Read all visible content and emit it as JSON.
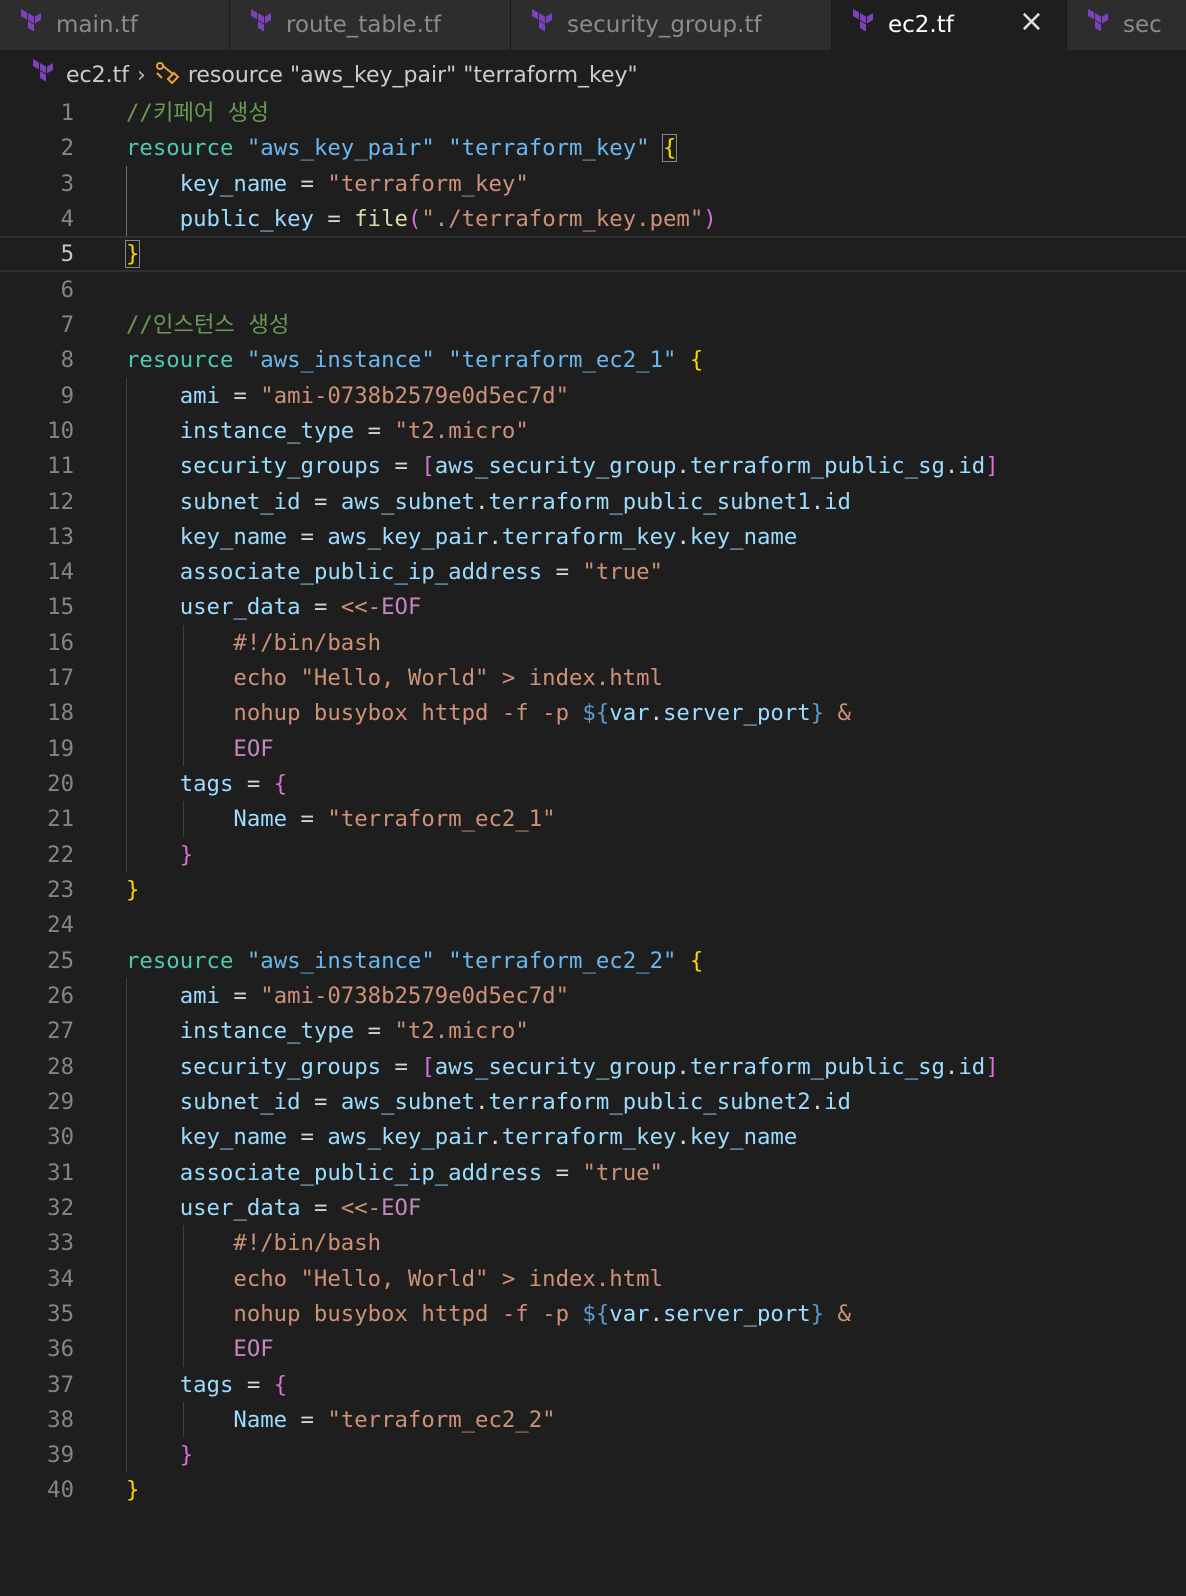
{
  "tabs": [
    {
      "label": "main.tf",
      "icon": "terraform-icon",
      "active": false
    },
    {
      "label": "route_table.tf",
      "icon": "terraform-icon",
      "active": false
    },
    {
      "label": "security_group.tf",
      "icon": "terraform-icon",
      "active": false
    },
    {
      "label": "ec2.tf",
      "icon": "terraform-icon",
      "active": true
    },
    {
      "label": "sec",
      "icon": "terraform-icon",
      "active": false
    }
  ],
  "breadcrumb": {
    "file": "ec2.tf",
    "symbol": "resource \"aws_key_pair\" \"terraform_key\""
  },
  "editor": {
    "current_line": 5,
    "lines": [
      [
        [
          "com",
          "//키페어 생성"
        ]
      ],
      [
        [
          "kw",
          "resource"
        ],
        [
          "p",
          " "
        ],
        [
          "lbl",
          "\"aws_key_pair\""
        ],
        [
          "p",
          " "
        ],
        [
          "lbl",
          "\"terraform_key\""
        ],
        [
          "p",
          " "
        ],
        [
          "b1bm",
          "{"
        ]
      ],
      [
        [
          "p",
          "    "
        ],
        [
          "var",
          "key_name"
        ],
        [
          "p",
          " = "
        ],
        [
          "str",
          "\"terraform_key\""
        ]
      ],
      [
        [
          "p",
          "    "
        ],
        [
          "var",
          "public_key"
        ],
        [
          "p",
          " = "
        ],
        [
          "fn",
          "file"
        ],
        [
          "b2",
          "("
        ],
        [
          "str",
          "\"./terraform_key.pem\""
        ],
        [
          "b2",
          ")"
        ]
      ],
      [
        [
          "b1bm",
          "}"
        ]
      ],
      [],
      [
        [
          "com",
          "//인스턴스 생성"
        ]
      ],
      [
        [
          "kw",
          "resource"
        ],
        [
          "p",
          " "
        ],
        [
          "lbl",
          "\"aws_instance\""
        ],
        [
          "p",
          " "
        ],
        [
          "lbl",
          "\"terraform_ec2_1\""
        ],
        [
          "p",
          " "
        ],
        [
          "b1",
          "{"
        ]
      ],
      [
        [
          "p",
          "    "
        ],
        [
          "var",
          "ami"
        ],
        [
          "p",
          " = "
        ],
        [
          "str",
          "\"ami-0738b2579e0d5ec7d\""
        ]
      ],
      [
        [
          "p",
          "    "
        ],
        [
          "var",
          "instance_type"
        ],
        [
          "p",
          " = "
        ],
        [
          "str",
          "\"t2.micro\""
        ]
      ],
      [
        [
          "p",
          "    "
        ],
        [
          "var",
          "security_groups"
        ],
        [
          "p",
          " = "
        ],
        [
          "b2",
          "["
        ],
        [
          "var",
          "aws_security_group"
        ],
        [
          "p",
          "."
        ],
        [
          "var",
          "terraform_public_sg"
        ],
        [
          "p",
          "."
        ],
        [
          "var",
          "id"
        ],
        [
          "b2",
          "]"
        ]
      ],
      [
        [
          "p",
          "    "
        ],
        [
          "var",
          "subnet_id"
        ],
        [
          "p",
          " = "
        ],
        [
          "var",
          "aws_subnet"
        ],
        [
          "p",
          "."
        ],
        [
          "var",
          "terraform_public_subnet1"
        ],
        [
          "p",
          "."
        ],
        [
          "var",
          "id"
        ]
      ],
      [
        [
          "p",
          "    "
        ],
        [
          "var",
          "key_name"
        ],
        [
          "p",
          " = "
        ],
        [
          "var",
          "aws_key_pair"
        ],
        [
          "p",
          "."
        ],
        [
          "var",
          "terraform_key"
        ],
        [
          "p",
          "."
        ],
        [
          "var",
          "key_name"
        ]
      ],
      [
        [
          "p",
          "    "
        ],
        [
          "var",
          "associate_public_ip_address"
        ],
        [
          "p",
          " = "
        ],
        [
          "str",
          "\"true\""
        ]
      ],
      [
        [
          "p",
          "    "
        ],
        [
          "var",
          "user_data"
        ],
        [
          "p",
          " = "
        ],
        [
          "str",
          "<<-"
        ],
        [
          "heredoc",
          "EOF"
        ]
      ],
      [
        [
          "str",
          "        #!/bin/bash"
        ]
      ],
      [
        [
          "str",
          "        echo \"Hello, World\" > index.html"
        ]
      ],
      [
        [
          "str",
          "        nohup busybox httpd -f -p "
        ],
        [
          "interp",
          "${"
        ],
        [
          "var",
          "var"
        ],
        [
          "p",
          "."
        ],
        [
          "var",
          "server_port"
        ],
        [
          "interp",
          "}"
        ],
        [
          "str",
          " &"
        ]
      ],
      [
        [
          "p",
          "        "
        ],
        [
          "heredoc",
          "EOF"
        ]
      ],
      [
        [
          "p",
          "    "
        ],
        [
          "var",
          "tags"
        ],
        [
          "p",
          " = "
        ],
        [
          "b2",
          "{"
        ]
      ],
      [
        [
          "p",
          "        "
        ],
        [
          "var",
          "Name"
        ],
        [
          "p",
          " = "
        ],
        [
          "str",
          "\"terraform_ec2_1\""
        ]
      ],
      [
        [
          "p",
          "    "
        ],
        [
          "b2",
          "}"
        ]
      ],
      [
        [
          "b1",
          "}"
        ]
      ],
      [],
      [
        [
          "kw",
          "resource"
        ],
        [
          "p",
          " "
        ],
        [
          "lbl",
          "\"aws_instance\""
        ],
        [
          "p",
          " "
        ],
        [
          "lbl",
          "\"terraform_ec2_2\""
        ],
        [
          "p",
          " "
        ],
        [
          "b1",
          "{"
        ]
      ],
      [
        [
          "p",
          "    "
        ],
        [
          "var",
          "ami"
        ],
        [
          "p",
          " = "
        ],
        [
          "str",
          "\"ami-0738b2579e0d5ec7d\""
        ]
      ],
      [
        [
          "p",
          "    "
        ],
        [
          "var",
          "instance_type"
        ],
        [
          "p",
          " = "
        ],
        [
          "str",
          "\"t2.micro\""
        ]
      ],
      [
        [
          "p",
          "    "
        ],
        [
          "var",
          "security_groups"
        ],
        [
          "p",
          " = "
        ],
        [
          "b2",
          "["
        ],
        [
          "var",
          "aws_security_group"
        ],
        [
          "p",
          "."
        ],
        [
          "var",
          "terraform_public_sg"
        ],
        [
          "p",
          "."
        ],
        [
          "var",
          "id"
        ],
        [
          "b2",
          "]"
        ]
      ],
      [
        [
          "p",
          "    "
        ],
        [
          "var",
          "subnet_id"
        ],
        [
          "p",
          " = "
        ],
        [
          "var",
          "aws_subnet"
        ],
        [
          "p",
          "."
        ],
        [
          "var",
          "terraform_public_subnet2"
        ],
        [
          "p",
          "."
        ],
        [
          "var",
          "id"
        ]
      ],
      [
        [
          "p",
          "    "
        ],
        [
          "var",
          "key_name"
        ],
        [
          "p",
          " = "
        ],
        [
          "var",
          "aws_key_pair"
        ],
        [
          "p",
          "."
        ],
        [
          "var",
          "terraform_key"
        ],
        [
          "p",
          "."
        ],
        [
          "var",
          "key_name"
        ]
      ],
      [
        [
          "p",
          "    "
        ],
        [
          "var",
          "associate_public_ip_address"
        ],
        [
          "p",
          " = "
        ],
        [
          "str",
          "\"true\""
        ]
      ],
      [
        [
          "p",
          "    "
        ],
        [
          "var",
          "user_data"
        ],
        [
          "p",
          " = "
        ],
        [
          "str",
          "<<-"
        ],
        [
          "heredoc",
          "EOF"
        ]
      ],
      [
        [
          "str",
          "        #!/bin/bash"
        ]
      ],
      [
        [
          "str",
          "        echo \"Hello, World\" > index.html"
        ]
      ],
      [
        [
          "str",
          "        nohup busybox httpd -f -p "
        ],
        [
          "interp",
          "${"
        ],
        [
          "var",
          "var"
        ],
        [
          "p",
          "."
        ],
        [
          "var",
          "server_port"
        ],
        [
          "interp",
          "}"
        ],
        [
          "str",
          " &"
        ]
      ],
      [
        [
          "p",
          "        "
        ],
        [
          "heredoc",
          "EOF"
        ]
      ],
      [
        [
          "p",
          "    "
        ],
        [
          "var",
          "tags"
        ],
        [
          "p",
          " = "
        ],
        [
          "b2",
          "{"
        ]
      ],
      [
        [
          "p",
          "        "
        ],
        [
          "var",
          "Name"
        ],
        [
          "p",
          " = "
        ],
        [
          "str",
          "\"terraform_ec2_2\""
        ]
      ],
      [
        [
          "p",
          "    "
        ],
        [
          "b2",
          "}"
        ]
      ],
      [
        [
          "b1",
          "}"
        ]
      ]
    ]
  },
  "colors": {
    "background": "#1e1e1e",
    "tab_inactive": "#2d2d2d",
    "terraform_icon": "#7b42bc",
    "keyword": "#4ec9b0",
    "string": "#ce9178",
    "comment": "#6a9955"
  }
}
